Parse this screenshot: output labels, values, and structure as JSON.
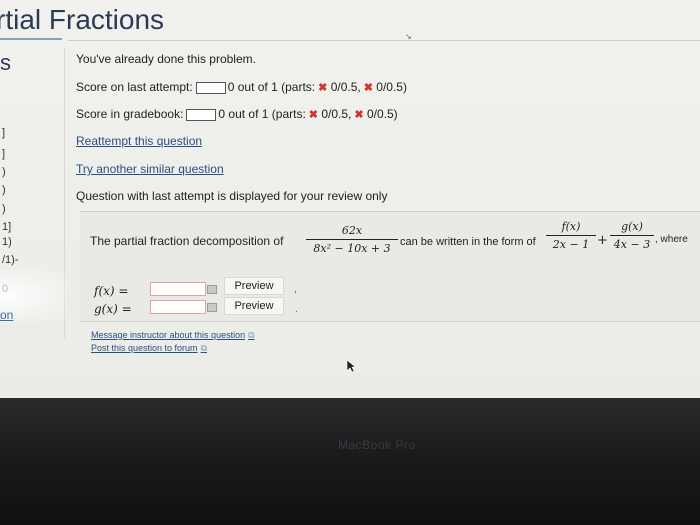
{
  "page_title": "rtial Fractions",
  "sidebar": {
    "letter": "s",
    "ticks": [
      "]",
      "]",
      ")",
      ")",
      ")",
      "1]",
      "1)",
      "/1)-"
    ],
    "zero": "0",
    "link": "on"
  },
  "status": {
    "already_done": "You've already done this problem.",
    "last_attempt_label": "Score on last attempt:",
    "last_attempt_value": "0 out of 1 (parts:",
    "last_attempt_part1": "0/0.5,",
    "last_attempt_part2": "0/0.5)",
    "gradebook_label": "Score in gradebook:",
    "gradebook_value": "0 out of 1 (parts:",
    "gradebook_part1": "0/0.5,",
    "gradebook_part2": "0/0.5)",
    "reattempt_link": "Reattempt this question",
    "similar_link": "Try another similar question",
    "review_note": "Question with last attempt is displayed for your review only"
  },
  "question": {
    "intro": "The partial fraction decomposition of",
    "main_num": "62x",
    "main_den": "8x² − 10x + 3",
    "middle": "can be written in the form of",
    "f_num": "f(x)",
    "f_den": "2x − 1",
    "plus": "+",
    "g_num": "g(x)",
    "g_den": "4x − 3",
    "where": ", where"
  },
  "answers": {
    "f_label": "f(x) =",
    "g_label": "g(x) =",
    "f_value": "",
    "g_value": "",
    "preview_label": "Preview"
  },
  "footer": {
    "message_link": "Message instructor about this question",
    "forum_link": "Post this question to forum"
  },
  "bezel_label": "MacBook Pro"
}
